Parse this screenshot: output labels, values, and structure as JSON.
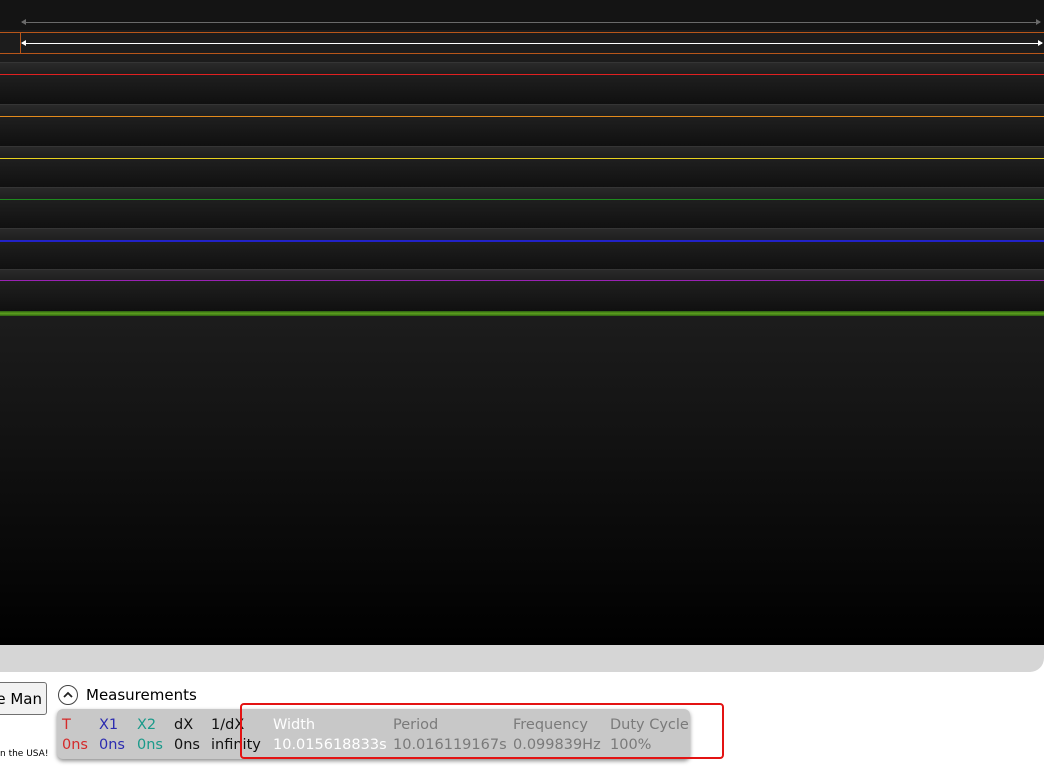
{
  "app": {
    "colors": {
      "trace_red": "#e02020",
      "trace_orange": "#e38a1c",
      "trace_yellow": "#e8d21e",
      "trace_green": "#1e8a1e",
      "trace_blue": "#2222c8",
      "trace_purple": "#9a22b4",
      "callout": "#e31313"
    }
  },
  "left_button": {
    "label": "e Man"
  },
  "measurements": {
    "title": "Measurements",
    "toggle_icon": "chevron-up-icon",
    "columns": [
      {
        "header": "T",
        "value": "0ns",
        "color": "#d42a2a"
      },
      {
        "header": "X1",
        "value": "0ns",
        "color": "#2b2bb0"
      },
      {
        "header": "X2",
        "value": "0ns",
        "color": "#1a9a8a"
      },
      {
        "header": "dX",
        "value": "0ns",
        "color": "#111111"
      },
      {
        "header": "1/dX",
        "value": "infinity",
        "color": "#111111"
      },
      {
        "header": "Width",
        "value": "10.015618833s",
        "color": "#ffffff"
      },
      {
        "header": "Period",
        "value": "10.016119167s",
        "color": "#7a7a7a"
      },
      {
        "header": "Frequency",
        "value": "0.099839Hz",
        "color": "#7a7a7a"
      },
      {
        "header": "Duty Cycle",
        "value": "100%",
        "color": "#7a7a7a"
      }
    ]
  },
  "footer": {
    "text": "n the USA!"
  }
}
